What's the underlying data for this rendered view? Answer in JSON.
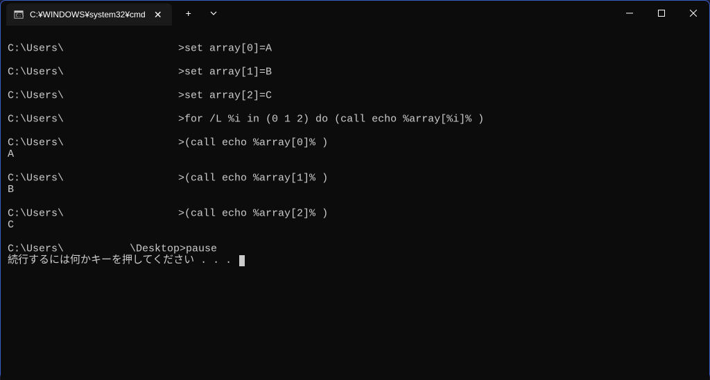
{
  "tab": {
    "title": "C:¥WINDOWS¥system32¥cmd"
  },
  "terminal": {
    "prompt_prefix": "C:\\Users\\",
    "prompt_suffix": ">",
    "prompt_suffix_desktop": "\\Desktop>",
    "lines": {
      "l1_cmd": "set array[0]=A",
      "l2_cmd": "set array[1]=B",
      "l3_cmd": "set array[2]=C",
      "l4_cmd": "for /L %i in (0 1 2) do (call echo %array[%i]% )",
      "l5_cmd": "(call echo %array[0]% )",
      "l5_out": "A",
      "l6_cmd": "(call echo %array[1]% )",
      "l6_out": "B",
      "l7_cmd": "(call echo %array[2]% )",
      "l7_out": "C",
      "l8_cmd": "pause",
      "l8_out": "続行するには何かキーを押してください . . . "
    }
  }
}
